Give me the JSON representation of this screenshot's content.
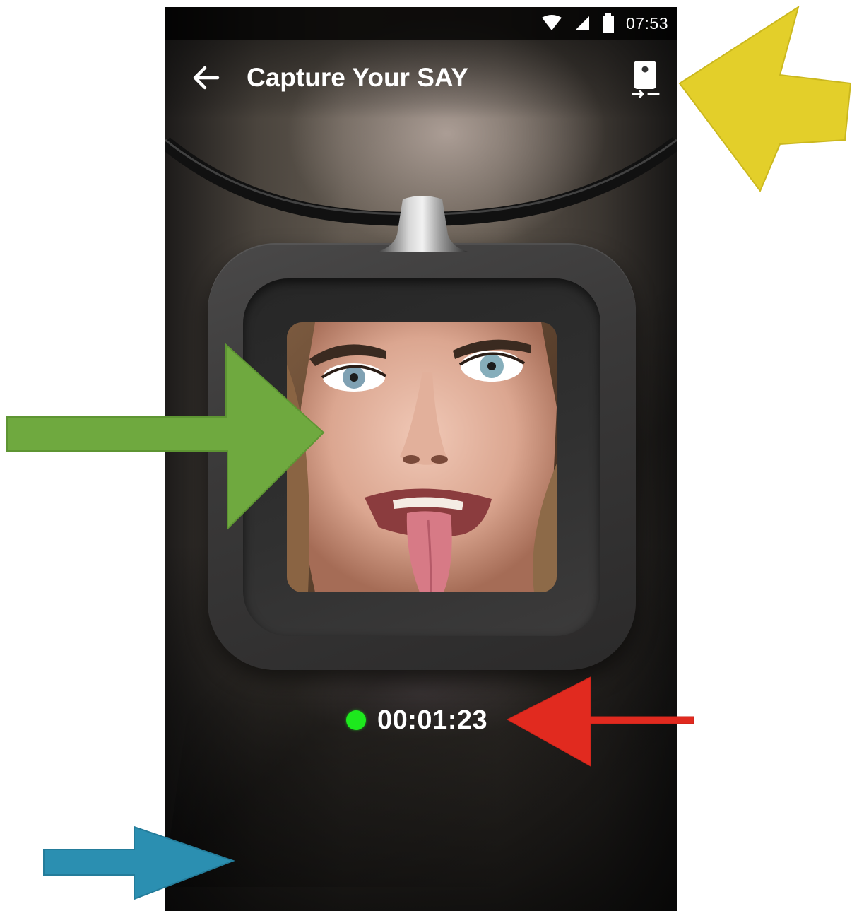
{
  "status_bar": {
    "time": "07:53",
    "icons": [
      "wifi-icon",
      "cell-signal-icon",
      "battery-icon"
    ]
  },
  "app_bar": {
    "back_icon": "arrow-left-icon",
    "title": "Capture Your SAY",
    "action_icon": "switch-camera-icon"
  },
  "pendant": {
    "preview": "camera-preview-face"
  },
  "recording": {
    "indicator_color": "#1de91d",
    "elapsed": "00:01:23"
  },
  "annotations": {
    "colors": {
      "yellow": "#e3cf2a",
      "green": "#6fa93f",
      "red": "#e12a1f",
      "blue": "#2b8fb1"
    }
  }
}
